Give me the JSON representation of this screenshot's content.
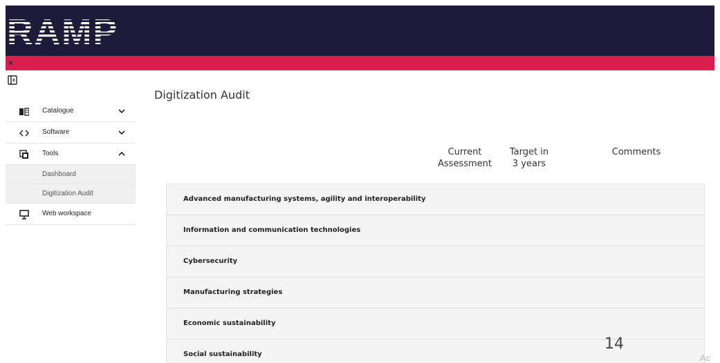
{
  "header": {
    "logo_text": "RAMP",
    "close_symbol": "×"
  },
  "sidebar": {
    "items": [
      {
        "label": "Catalogue",
        "icon": "book-icon",
        "expanded": false
      },
      {
        "label": "Software",
        "icon": "code-icon",
        "expanded": false
      },
      {
        "label": "Tools",
        "icon": "tools-icon",
        "expanded": true,
        "children": [
          {
            "label": "Dashboard"
          },
          {
            "label": "Digitization Audit"
          }
        ]
      },
      {
        "label": "Web workspace",
        "icon": "monitor-icon",
        "expanded": false
      }
    ]
  },
  "main": {
    "title": "Digitization Audit",
    "columns": {
      "current_line1": "Current",
      "current_line2": "Assessment",
      "target_line1": "Target in",
      "target_line2": "3 years",
      "comments": "Comments"
    },
    "rows": [
      "Advanced manufacturing systems, agility and interoperability",
      "Information and communication technologies",
      "Cybersecurity",
      "Manufacturing strategies",
      "Economic sustainability",
      "Social sustainability"
    ]
  },
  "slide": {
    "page_number": "14",
    "watermark": "Ac"
  },
  "colors": {
    "header_bg": "#1d1a3a",
    "accent_red": "#d91f4d"
  }
}
